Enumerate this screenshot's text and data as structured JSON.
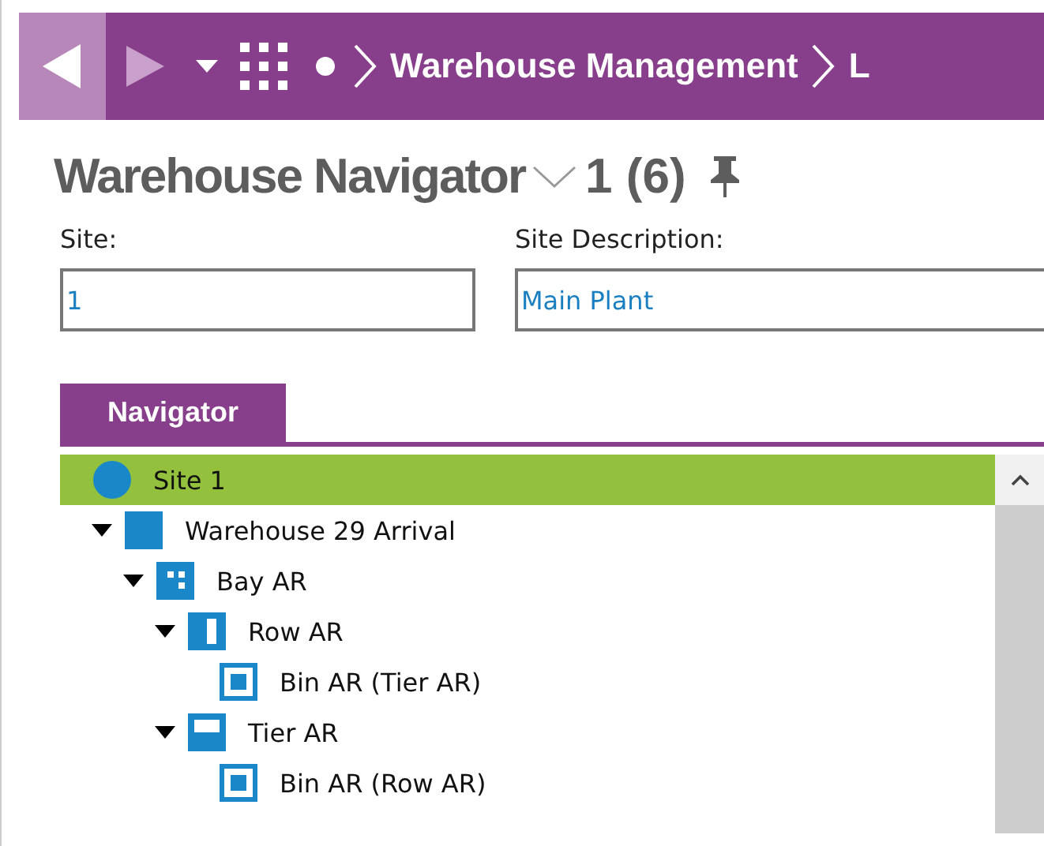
{
  "nav_bar": {
    "breadcrumbs": [
      "Warehouse Management",
      "L"
    ]
  },
  "header": {
    "title": "Warehouse Navigator",
    "record_count": "1 (6)"
  },
  "fields": [
    {
      "label": "Site:",
      "value": "1"
    },
    {
      "label": "Site Description:",
      "value": "Main Plant"
    }
  ],
  "tabs": [
    {
      "label": "Navigator",
      "selected": true
    }
  ],
  "tree": [
    {
      "label": "Site 1",
      "kind": "site",
      "selected": true,
      "children": [
        {
          "label": "Warehouse 29 Arrival",
          "kind": "warehouse",
          "selected": false,
          "expanded": true,
          "children": [
            {
              "label": "Bay AR",
              "kind": "bay",
              "selected": false,
              "expanded": true,
              "children": [
                {
                  "label": "Row AR",
                  "kind": "row",
                  "selected": false,
                  "expanded": true,
                  "children": [
                    {
                      "label": "Bin AR (Tier AR)",
                      "kind": "bin",
                      "selected": false
                    }
                  ]
                },
                {
                  "label": "Tier AR",
                  "kind": "tier",
                  "selected": false,
                  "expanded": true,
                  "children": [
                    {
                      "label": "Bin AR (Row AR)",
                      "kind": "bin",
                      "selected": false
                    }
                  ]
                }
              ]
            }
          ]
        }
      ]
    }
  ]
}
